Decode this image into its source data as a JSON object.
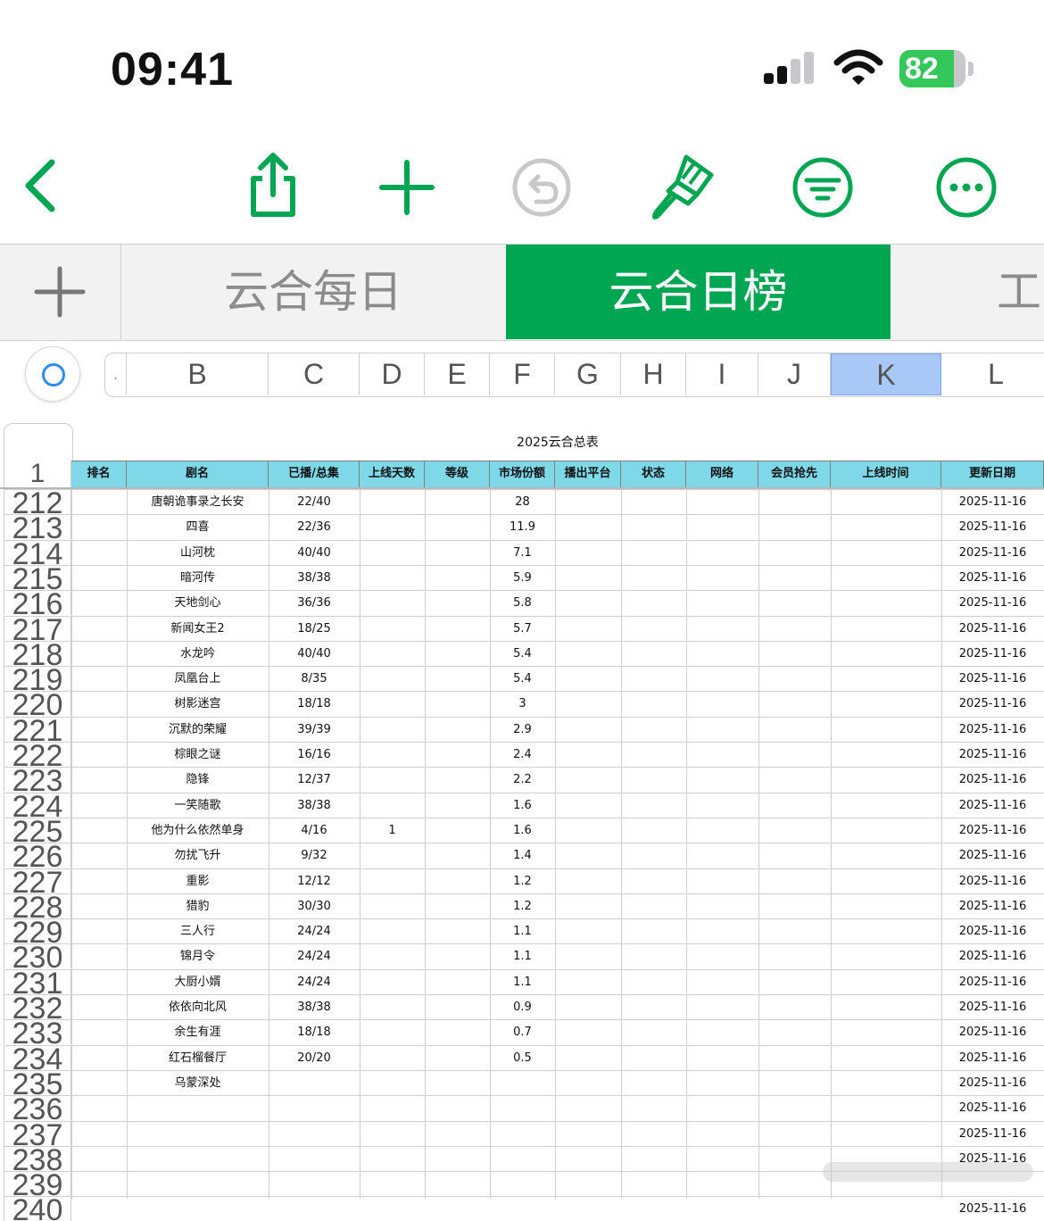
{
  "status_bar": {
    "time": "09:41",
    "battery_level": "82",
    "battery_fraction": 0.82
  },
  "toolbar": {
    "back": "chevron-left-icon",
    "share": "share-icon",
    "add": "plus-icon",
    "undo": "undo-icon",
    "format": "paintbrush-icon",
    "filter": "filter-icon",
    "more": "ellipsis-icon",
    "accent_color": "#00a651"
  },
  "sheets": {
    "add_label": "+",
    "tabs": [
      {
        "label": "云合每日",
        "active": false
      },
      {
        "label": "云合日榜",
        "active": true
      },
      {
        "label": "工",
        "active": false
      }
    ]
  },
  "columns": [
    "B",
    "C",
    "D",
    "E",
    "F",
    "G",
    "H",
    "I",
    "J",
    "K",
    "L"
  ],
  "selected_column": "K",
  "table": {
    "title": "2025云合总表",
    "header_row_number": "1",
    "headers": [
      "排名",
      "剧名",
      "已播/总集",
      "上线天数",
      "等级",
      "市场份额",
      "播出平台",
      "状态",
      "网络",
      "会员抢先",
      "上线时间",
      "更新日期"
    ],
    "header_color": "#7fd8e8",
    "rows": [
      {
        "n": "212",
        "name": "唐朝诡事录之长安",
        "ep": "22/40",
        "days": "",
        "share": "28",
        "date": "2025-11-16"
      },
      {
        "n": "213",
        "name": "四喜",
        "ep": "22/36",
        "days": "",
        "share": "11.9",
        "date": "2025-11-16"
      },
      {
        "n": "214",
        "name": "山河枕",
        "ep": "40/40",
        "days": "",
        "share": "7.1",
        "date": "2025-11-16"
      },
      {
        "n": "215",
        "name": "暗河传",
        "ep": "38/38",
        "days": "",
        "share": "5.9",
        "date": "2025-11-16"
      },
      {
        "n": "216",
        "name": "天地剑心",
        "ep": "36/36",
        "days": "",
        "share": "5.8",
        "date": "2025-11-16"
      },
      {
        "n": "217",
        "name": "新闻女王2",
        "ep": "18/25",
        "days": "",
        "share": "5.7",
        "date": "2025-11-16"
      },
      {
        "n": "218",
        "name": "水龙吟",
        "ep": "40/40",
        "days": "",
        "share": "5.4",
        "date": "2025-11-16"
      },
      {
        "n": "219",
        "name": "凤凰台上",
        "ep": "8/35",
        "days": "",
        "share": "5.4",
        "date": "2025-11-16"
      },
      {
        "n": "220",
        "name": "树影迷宫",
        "ep": "18/18",
        "days": "",
        "share": "3",
        "date": "2025-11-16"
      },
      {
        "n": "221",
        "name": "沉默的荣耀",
        "ep": "39/39",
        "days": "",
        "share": "2.9",
        "date": "2025-11-16"
      },
      {
        "n": "222",
        "name": "棕眼之谜",
        "ep": "16/16",
        "days": "",
        "share": "2.4",
        "date": "2025-11-16"
      },
      {
        "n": "223",
        "name": "隐锋",
        "ep": "12/37",
        "days": "",
        "share": "2.2",
        "date": "2025-11-16"
      },
      {
        "n": "224",
        "name": "一笑随歌",
        "ep": "38/38",
        "days": "",
        "share": "1.6",
        "date": "2025-11-16"
      },
      {
        "n": "225",
        "name": "他为什么依然单身",
        "ep": "4/16",
        "days": "1",
        "share": "1.6",
        "date": "2025-11-16"
      },
      {
        "n": "226",
        "name": "勿扰飞升",
        "ep": "9/32",
        "days": "",
        "share": "1.4",
        "date": "2025-11-16"
      },
      {
        "n": "227",
        "name": "重影",
        "ep": "12/12",
        "days": "",
        "share": "1.2",
        "date": "2025-11-16"
      },
      {
        "n": "228",
        "name": "猎豹",
        "ep": "30/30",
        "days": "",
        "share": "1.2",
        "date": "2025-11-16"
      },
      {
        "n": "229",
        "name": "三人行",
        "ep": "24/24",
        "days": "",
        "share": "1.1",
        "date": "2025-11-16"
      },
      {
        "n": "230",
        "name": "锦月令",
        "ep": "24/24",
        "days": "",
        "share": "1.1",
        "date": "2025-11-16"
      },
      {
        "n": "231",
        "name": "大厨小婿",
        "ep": "24/24",
        "days": "",
        "share": "1.1",
        "date": "2025-11-16"
      },
      {
        "n": "232",
        "name": "依依向北风",
        "ep": "38/38",
        "days": "",
        "share": "0.9",
        "date": "2025-11-16"
      },
      {
        "n": "233",
        "name": "余生有涯",
        "ep": "18/18",
        "days": "",
        "share": "0.7",
        "date": "2025-11-16"
      },
      {
        "n": "234",
        "name": "红石榴餐厅",
        "ep": "20/20",
        "days": "",
        "share": "0.5",
        "date": "2025-11-16"
      },
      {
        "n": "235",
        "name": "乌蒙深处",
        "ep": "",
        "days": "",
        "share": "",
        "date": "2025-11-16"
      },
      {
        "n": "236",
        "name": "",
        "ep": "",
        "days": "",
        "share": "",
        "date": "2025-11-16"
      },
      {
        "n": "237",
        "name": "",
        "ep": "",
        "days": "",
        "share": "",
        "date": "2025-11-16"
      },
      {
        "n": "238",
        "name": "",
        "ep": "",
        "days": "",
        "share": "",
        "date": "2025-11-16"
      },
      {
        "n": "239",
        "name": "",
        "ep": "",
        "days": "",
        "share": "",
        "date": ""
      },
      {
        "n": "240",
        "name": "",
        "ep": "",
        "days": "",
        "share": "",
        "date": "2025-11-16"
      }
    ]
  }
}
